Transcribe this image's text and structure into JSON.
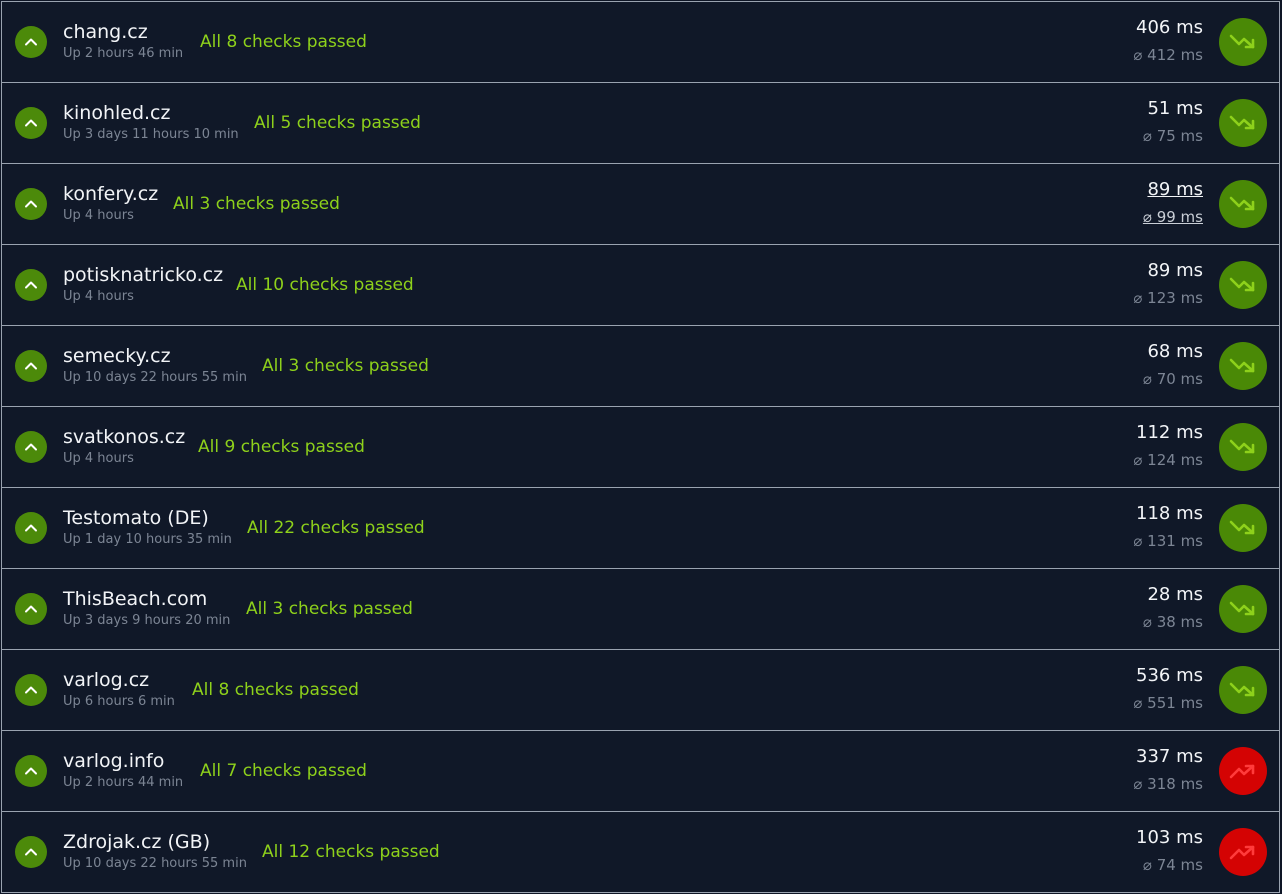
{
  "colors": {
    "background": "#0e1525",
    "status_ok": "#8ed11b",
    "badge_green": "#4c8a0a",
    "trend_green": "#4a8906",
    "trend_red": "#d40303"
  },
  "monitors": [
    {
      "name": "chang.cz",
      "uptime": "Up 2 hours 46 min",
      "checks": "All 8 checks passed",
      "response": "406 ms",
      "average": "⌀ 412 ms",
      "trend": "down",
      "status_icon": "chevron-up-icon"
    },
    {
      "name": "kinohled.cz",
      "uptime": "Up 3 days 11 hours 10 min",
      "checks": "All 5 checks passed",
      "response": "51 ms",
      "average": "⌀ 75 ms",
      "trend": "down",
      "status_icon": "chevron-up-icon"
    },
    {
      "name": "konfery.cz",
      "uptime": "Up 4 hours",
      "checks": "All 3 checks passed",
      "response": "89 ms",
      "average": "⌀ 99 ms",
      "trend": "down",
      "status_icon": "chevron-up-icon",
      "hovered": true
    },
    {
      "name": "potisknatricko.cz",
      "uptime": "Up 4 hours",
      "checks": "All 10 checks passed",
      "response": "89 ms",
      "average": "⌀ 123 ms",
      "trend": "down",
      "status_icon": "chevron-up-icon"
    },
    {
      "name": "semecky.cz",
      "uptime": "Up 10 days 22 hours 55 min",
      "checks": "All 3 checks passed",
      "response": "68 ms",
      "average": "⌀ 70 ms",
      "trend": "down",
      "status_icon": "chevron-up-icon"
    },
    {
      "name": "svatkonos.cz",
      "uptime": "Up 4 hours",
      "checks": "All 9 checks passed",
      "response": "112 ms",
      "average": "⌀ 124 ms",
      "trend": "down",
      "status_icon": "chevron-up-icon"
    },
    {
      "name": "Testomato (DE)",
      "uptime": "Up 1 day 10 hours 35 min",
      "checks": "All 22 checks passed",
      "response": "118 ms",
      "average": "⌀ 131 ms",
      "trend": "down",
      "status_icon": "chevron-up-icon"
    },
    {
      "name": "ThisBeach.com",
      "uptime": "Up 3 days 9 hours 20 min",
      "checks": "All 3 checks passed",
      "response": "28 ms",
      "average": "⌀ 38 ms",
      "trend": "down",
      "status_icon": "chevron-up-icon"
    },
    {
      "name": "varlog.cz",
      "uptime": "Up 6 hours 6 min",
      "checks": "All 8 checks passed",
      "response": "536 ms",
      "average": "⌀ 551 ms",
      "trend": "down",
      "status_icon": "chevron-up-icon"
    },
    {
      "name": "varlog.info",
      "uptime": "Up 2 hours 44 min",
      "checks": "All 7 checks passed",
      "response": "337 ms",
      "average": "⌀ 318 ms",
      "trend": "up",
      "status_icon": "chevron-up-icon"
    },
    {
      "name": "Zdrojak.cz (GB)",
      "uptime": "Up 10 days 22 hours 55 min",
      "checks": "All 12 checks passed",
      "response": "103 ms",
      "average": "⌀ 74 ms",
      "trend": "up",
      "status_icon": "chevron-up-icon"
    }
  ]
}
